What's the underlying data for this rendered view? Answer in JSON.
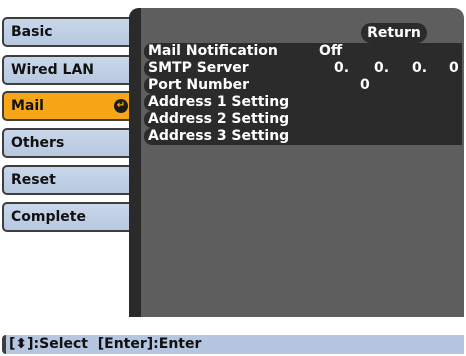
{
  "menu": {
    "items": [
      {
        "label": "Basic"
      },
      {
        "label": "Wired LAN"
      },
      {
        "label": "Mail",
        "selected": true
      },
      {
        "label": "Others"
      },
      {
        "label": "Reset"
      },
      {
        "label": "Complete"
      }
    ],
    "enter_icon_glyph": "↵"
  },
  "panel": {
    "return_label": "Return",
    "rows": [
      {
        "label": "Mail Notification",
        "value": "Off"
      },
      {
        "label": "SMTP Server",
        "ip": [
          "0.",
          "0.",
          "0.",
          "0"
        ]
      },
      {
        "label": "Port Number",
        "value": "0"
      },
      {
        "label": "Address 1 Setting"
      },
      {
        "label": "Address 2 Setting"
      },
      {
        "label": "Address 3 Setting"
      }
    ]
  },
  "help": {
    "text": "[⬍]:Select  [Enter]:Enter"
  },
  "colors": {
    "tab_bg": "#b7c8e0",
    "selected_tab": "#f7a617",
    "panel_bg": "#5e5e5e",
    "row_bg": "#2b2b2b"
  }
}
